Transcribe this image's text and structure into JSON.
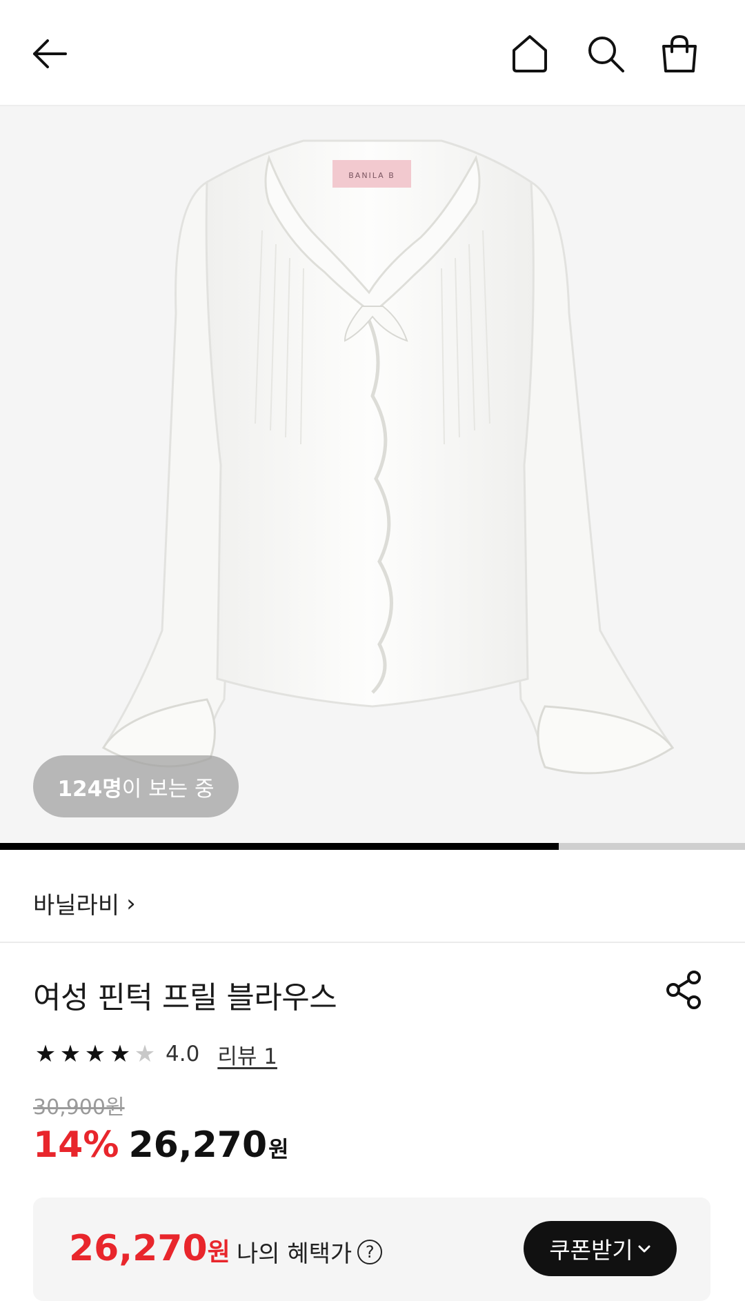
{
  "header": {
    "back_icon": "arrow-left-icon",
    "home_icon": "home-icon",
    "search_icon": "search-icon",
    "cart_icon": "shopping-bag-icon"
  },
  "hero": {
    "viewers_count": "124명",
    "viewers_suffix": "이 보는 중",
    "label_text": "BANILA B",
    "image_progress": 0.75
  },
  "product": {
    "brand": "바닐라비",
    "brand_chevron": "›",
    "title": "여성 핀턱 프릴 블라우스",
    "rating": 4,
    "rating_max": 5,
    "rating_value": "4.0",
    "review_link": "리뷰 1",
    "original_price": "30,900원",
    "discount": "14%",
    "price": "26,270",
    "price_unit": "원"
  },
  "benefit": {
    "price": "26,270",
    "price_unit": "원",
    "label": "나의 혜택가",
    "help": "?",
    "coupon_button": "쿠폰받기",
    "coupon_chevron": "⌄"
  },
  "colors": {
    "accent_red": "#e8262c",
    "black": "#111111",
    "image_bg": "#f5f5f5"
  }
}
